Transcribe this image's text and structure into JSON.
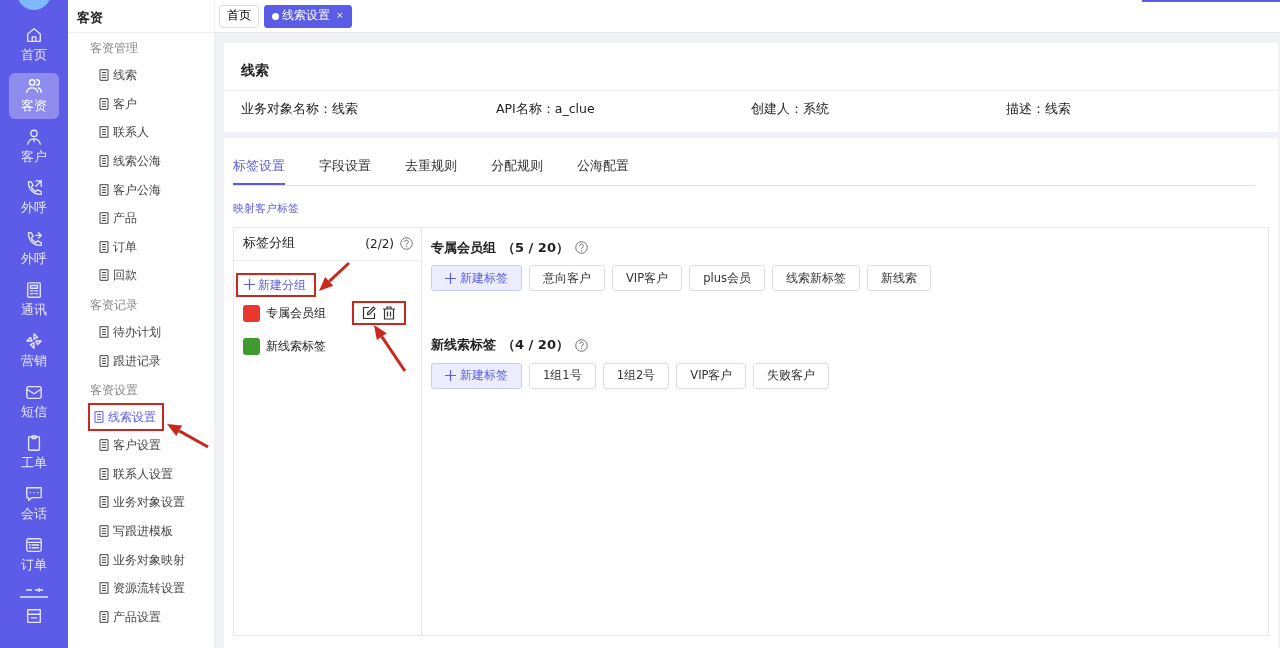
{
  "rail": {
    "items": [
      {
        "label": "首页",
        "selected": false
      },
      {
        "label": "客资",
        "selected": true
      },
      {
        "label": "客户",
        "selected": false
      },
      {
        "label": "外呼",
        "selected": false
      },
      {
        "label": "外呼",
        "selected": false
      },
      {
        "label": "通讯",
        "selected": false
      },
      {
        "label": "营销",
        "selected": false
      },
      {
        "label": "短信",
        "selected": false
      },
      {
        "label": "工单",
        "selected": false
      },
      {
        "label": "会话",
        "selected": false
      },
      {
        "label": "订单",
        "selected": false
      }
    ]
  },
  "sidebar": {
    "title": "客资",
    "sections": [
      {
        "title": "客资管理",
        "items": [
          {
            "label": "线索",
            "selected": false,
            "highlighted": false
          },
          {
            "label": "客户",
            "selected": false,
            "highlighted": false
          },
          {
            "label": "联系人",
            "selected": false,
            "highlighted": false
          },
          {
            "label": "线索公海",
            "selected": false,
            "highlighted": false
          },
          {
            "label": "客户公海",
            "selected": false,
            "highlighted": false
          },
          {
            "label": "产品",
            "selected": false,
            "highlighted": false
          },
          {
            "label": "订单",
            "selected": false,
            "highlighted": false
          },
          {
            "label": "回款",
            "selected": false,
            "highlighted": false
          }
        ]
      },
      {
        "title": "客资记录",
        "items": [
          {
            "label": "待办计划",
            "selected": false,
            "highlighted": false
          },
          {
            "label": "跟进记录",
            "selected": false,
            "highlighted": false
          }
        ]
      },
      {
        "title": "客资设置",
        "items": [
          {
            "label": "线索设置",
            "selected": true,
            "highlighted": true
          },
          {
            "label": "客户设置",
            "selected": false,
            "highlighted": false
          },
          {
            "label": "联系人设置",
            "selected": false,
            "highlighted": false
          },
          {
            "label": "业务对象设置",
            "selected": false,
            "highlighted": false
          },
          {
            "label": "写跟进模板",
            "selected": false,
            "highlighted": false
          },
          {
            "label": "业务对象映射",
            "selected": false,
            "highlighted": false
          },
          {
            "label": "资源流转设置",
            "selected": false,
            "highlighted": false
          },
          {
            "label": "产品设置",
            "selected": false,
            "highlighted": false
          }
        ]
      }
    ]
  },
  "page_tabs": [
    {
      "label": "首页",
      "selected": false
    },
    {
      "label": "线索设置",
      "selected": true,
      "close": "×"
    }
  ],
  "loading_bar": {
    "level": 0.13
  },
  "header": {
    "title": "线索",
    "fields": [
      "业务对象名称：线索",
      "API名称：a_clue",
      "创建人：系统",
      "描述：线索"
    ]
  },
  "settings_tabs": [
    {
      "label": "标签设置",
      "selected": true
    },
    {
      "label": "字段设置",
      "selected": false
    },
    {
      "label": "去重规则",
      "selected": false
    },
    {
      "label": "分配规则",
      "selected": false
    },
    {
      "label": "公海配置",
      "selected": false
    }
  ],
  "map_link": "映射客户标签",
  "groups_panel": {
    "title": "标签分组",
    "count": "(2/2)",
    "new_button": {
      "label": "新建分组",
      "highlighted": true
    },
    "groups": [
      {
        "name": "专属会员组",
        "color": "#e8372c",
        "show_actions": true,
        "actions_highlighted": true
      },
      {
        "name": "新线索标签",
        "color": "#3f9a32",
        "show_actions": false
      }
    ]
  },
  "tag_sections": [
    {
      "title": "专属会员组",
      "count": "（5 / 20）",
      "new_label": "新建标签",
      "tags": [
        "意向客户",
        "VIP客户",
        "plus会员",
        "线索新标签",
        "新线索"
      ]
    },
    {
      "title": "新线索标签",
      "count": "（4 / 20）",
      "new_label": "新建标签",
      "tags": [
        "1组1号",
        "1组2号",
        "VIP客户",
        "失败客户"
      ]
    }
  ]
}
